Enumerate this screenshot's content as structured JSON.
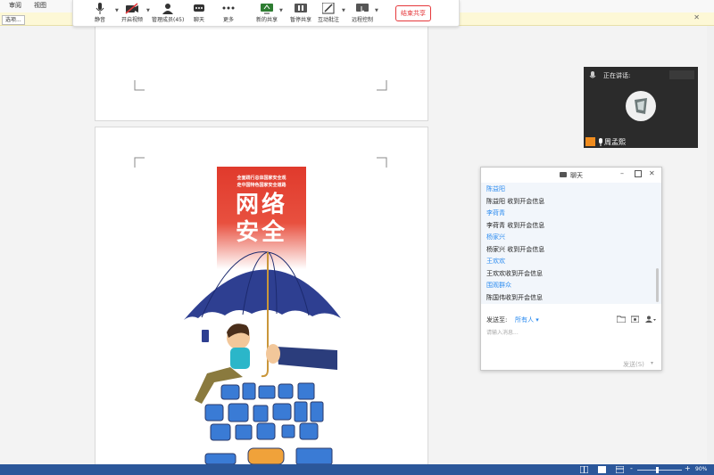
{
  "ribbon": {
    "tabs": [
      "审阅",
      "视图"
    ]
  },
  "yellowbar": {
    "button": "选项..."
  },
  "toolbar": {
    "buttons": [
      "静音",
      "开启视频",
      "管理成员(45)",
      "聊天",
      "更多",
      "新的共享",
      "暂停共享",
      "互动批注",
      "远程控制"
    ],
    "end_button": "结束共享"
  },
  "speaking": {
    "label": "正在讲话:",
    "user": "周孟熙"
  },
  "poster": {
    "line1": "全面践行总体国家安全观",
    "line2": "走中国特色国家安全道路",
    "title1": "网络",
    "title2": "安全"
  },
  "chat": {
    "title": "聊天",
    "messages": [
      {
        "type": "name",
        "text": "陈益阳"
      },
      {
        "type": "text",
        "text": "陈益阳 收到开会信息"
      },
      {
        "type": "name",
        "text": "李荷青"
      },
      {
        "type": "text",
        "text": "李荷青 收到开会信息"
      },
      {
        "type": "name",
        "text": "杨家兴"
      },
      {
        "type": "text",
        "text": "杨家兴  收到开会信息"
      },
      {
        "type": "name",
        "text": "王欢欢"
      },
      {
        "type": "text",
        "text": "王欢欢收到开会信息"
      },
      {
        "type": "name",
        "text": "围观群众"
      },
      {
        "type": "text",
        "text": "陈国伟收到开会信息"
      }
    ],
    "send_to_label": "发送至:",
    "send_to_value": "所有人",
    "input_placeholder": "请输入消息...",
    "send_label": "发送(S)"
  },
  "statusbar": {
    "zoom": "90%"
  },
  "colors": {
    "accent": "#2d8cf0",
    "end": "#e5383b",
    "status": "#2b579a",
    "poster_red": "#e03a2c",
    "umbrella": "#2e3f91"
  }
}
